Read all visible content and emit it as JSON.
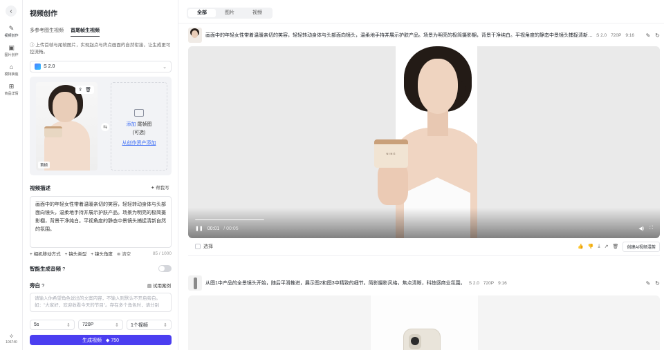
{
  "rail": {
    "items": [
      {
        "label": "视频创作",
        "icon": "video-edit-icon"
      },
      {
        "label": "图片创作",
        "icon": "image-edit-icon"
      },
      {
        "label": "模特换装",
        "icon": "outfit-icon"
      },
      {
        "label": "商品详情",
        "icon": "product-detail-icon"
      }
    ],
    "credits": "106740"
  },
  "panel": {
    "title": "视频创作",
    "subtabs": [
      "多参考图生视频",
      "首尾帧生视频"
    ],
    "active_subtab": "首尾帧生视频",
    "hint": "上传首帧与尾帧图片，实现起点与终点画面的自然衔接，让生成更可控流畅。",
    "model": "S 2.0",
    "first_frame_tag": "首帧",
    "last_frame": {
      "add": "添加",
      "label": "尾帧图",
      "optional": "(可选)",
      "from_assets": "从创作资产添加"
    },
    "desc_title": "视频描述",
    "help_write": "帮我写",
    "description": "画面中的年轻女性带着温暖亲切的笑容，轻轻转动身体与头部面向镜头，温柔地手持并展示护肤产品。场景为明亮的极简摄影棚，背景干净纯白。平视角度的静态中景镜头捕捉清新自然的氛围。",
    "chips": [
      "+ 相机移动方式",
      "+ 镜头类型",
      "+ 镜头角度"
    ],
    "clear": "清空",
    "count": "85 / 1000",
    "audio_label": "智能生成音频",
    "voice_label": "旁白",
    "voice_example": "试用案例",
    "voice_placeholder": "请输入你希望角色说出的文案内容，不输入则默认不开启旁白。如：\"大家好，欢迎收看今天的节目\"。存在多个角色时，请分别",
    "duration": "5s",
    "resolution": "720P",
    "quantity": "1个视频",
    "generate": "生成视频",
    "cost": "◆ 750"
  },
  "main": {
    "filters": [
      "全部",
      "图片",
      "视频"
    ],
    "active_filter": "全部",
    "cards": [
      {
        "prompt": "画面中的年轻女性带着温暖亲切的笑容，轻轻转动身体与头部面向镜头，温柔地手持并展示护肤产品。场景为明亮的极简摄影棚，背景干净纯白。平视角度的静态中景镜头捕捉清新自然的氛...",
        "model": "S 2.0",
        "resolution": "720P",
        "ratio": "9:16",
        "time_current": "00:01",
        "time_total": "/ 00:05",
        "select_label": "选择",
        "ai_button": "创建AI视频混剪",
        "jar_text": "NING"
      },
      {
        "prompt": "从图1中产品的全景镜头开始，随后平滑推进，展示图2和图3中精致的细节。简影摄影风格，焦点清晰，科技感商业氛围。",
        "model": "S 2.0",
        "resolution": "720P",
        "ratio": "9:16"
      }
    ]
  }
}
